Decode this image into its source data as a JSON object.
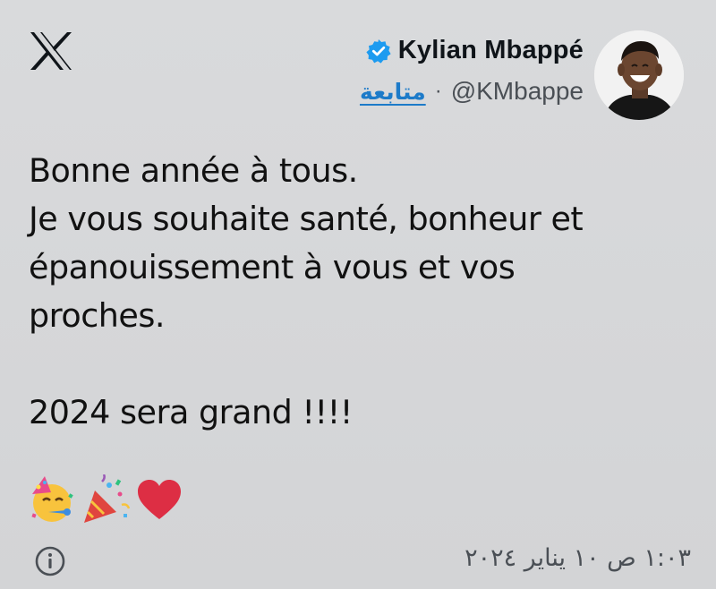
{
  "tweet": {
    "author": {
      "display_name": "Kylian Mbappé",
      "handle": "@KMbappe",
      "follow_label": "متابعة",
      "separator": "·"
    },
    "text_lines": [
      "Bonne année à tous.",
      "Je vous souhaite santé, bonheur et",
      "épanouissement à vous et vos",
      "proches.",
      "",
      "2024 sera grand !!!!"
    ],
    "emojis": [
      "partying-face-emoji",
      "party-popper-emoji",
      "red-heart-emoji"
    ],
    "timestamp": "١:٠٣ ص ١٠ يناير ٢٠٢٤"
  },
  "icons": {
    "logo": "x-logo-icon",
    "verified": "verified-badge-icon",
    "info": "info-icon"
  },
  "colors": {
    "background": "#d5d6d8",
    "link": "#1d7bc9",
    "verified": "#1d9bf0",
    "text": "#111111",
    "muted": "#4a4f55"
  }
}
